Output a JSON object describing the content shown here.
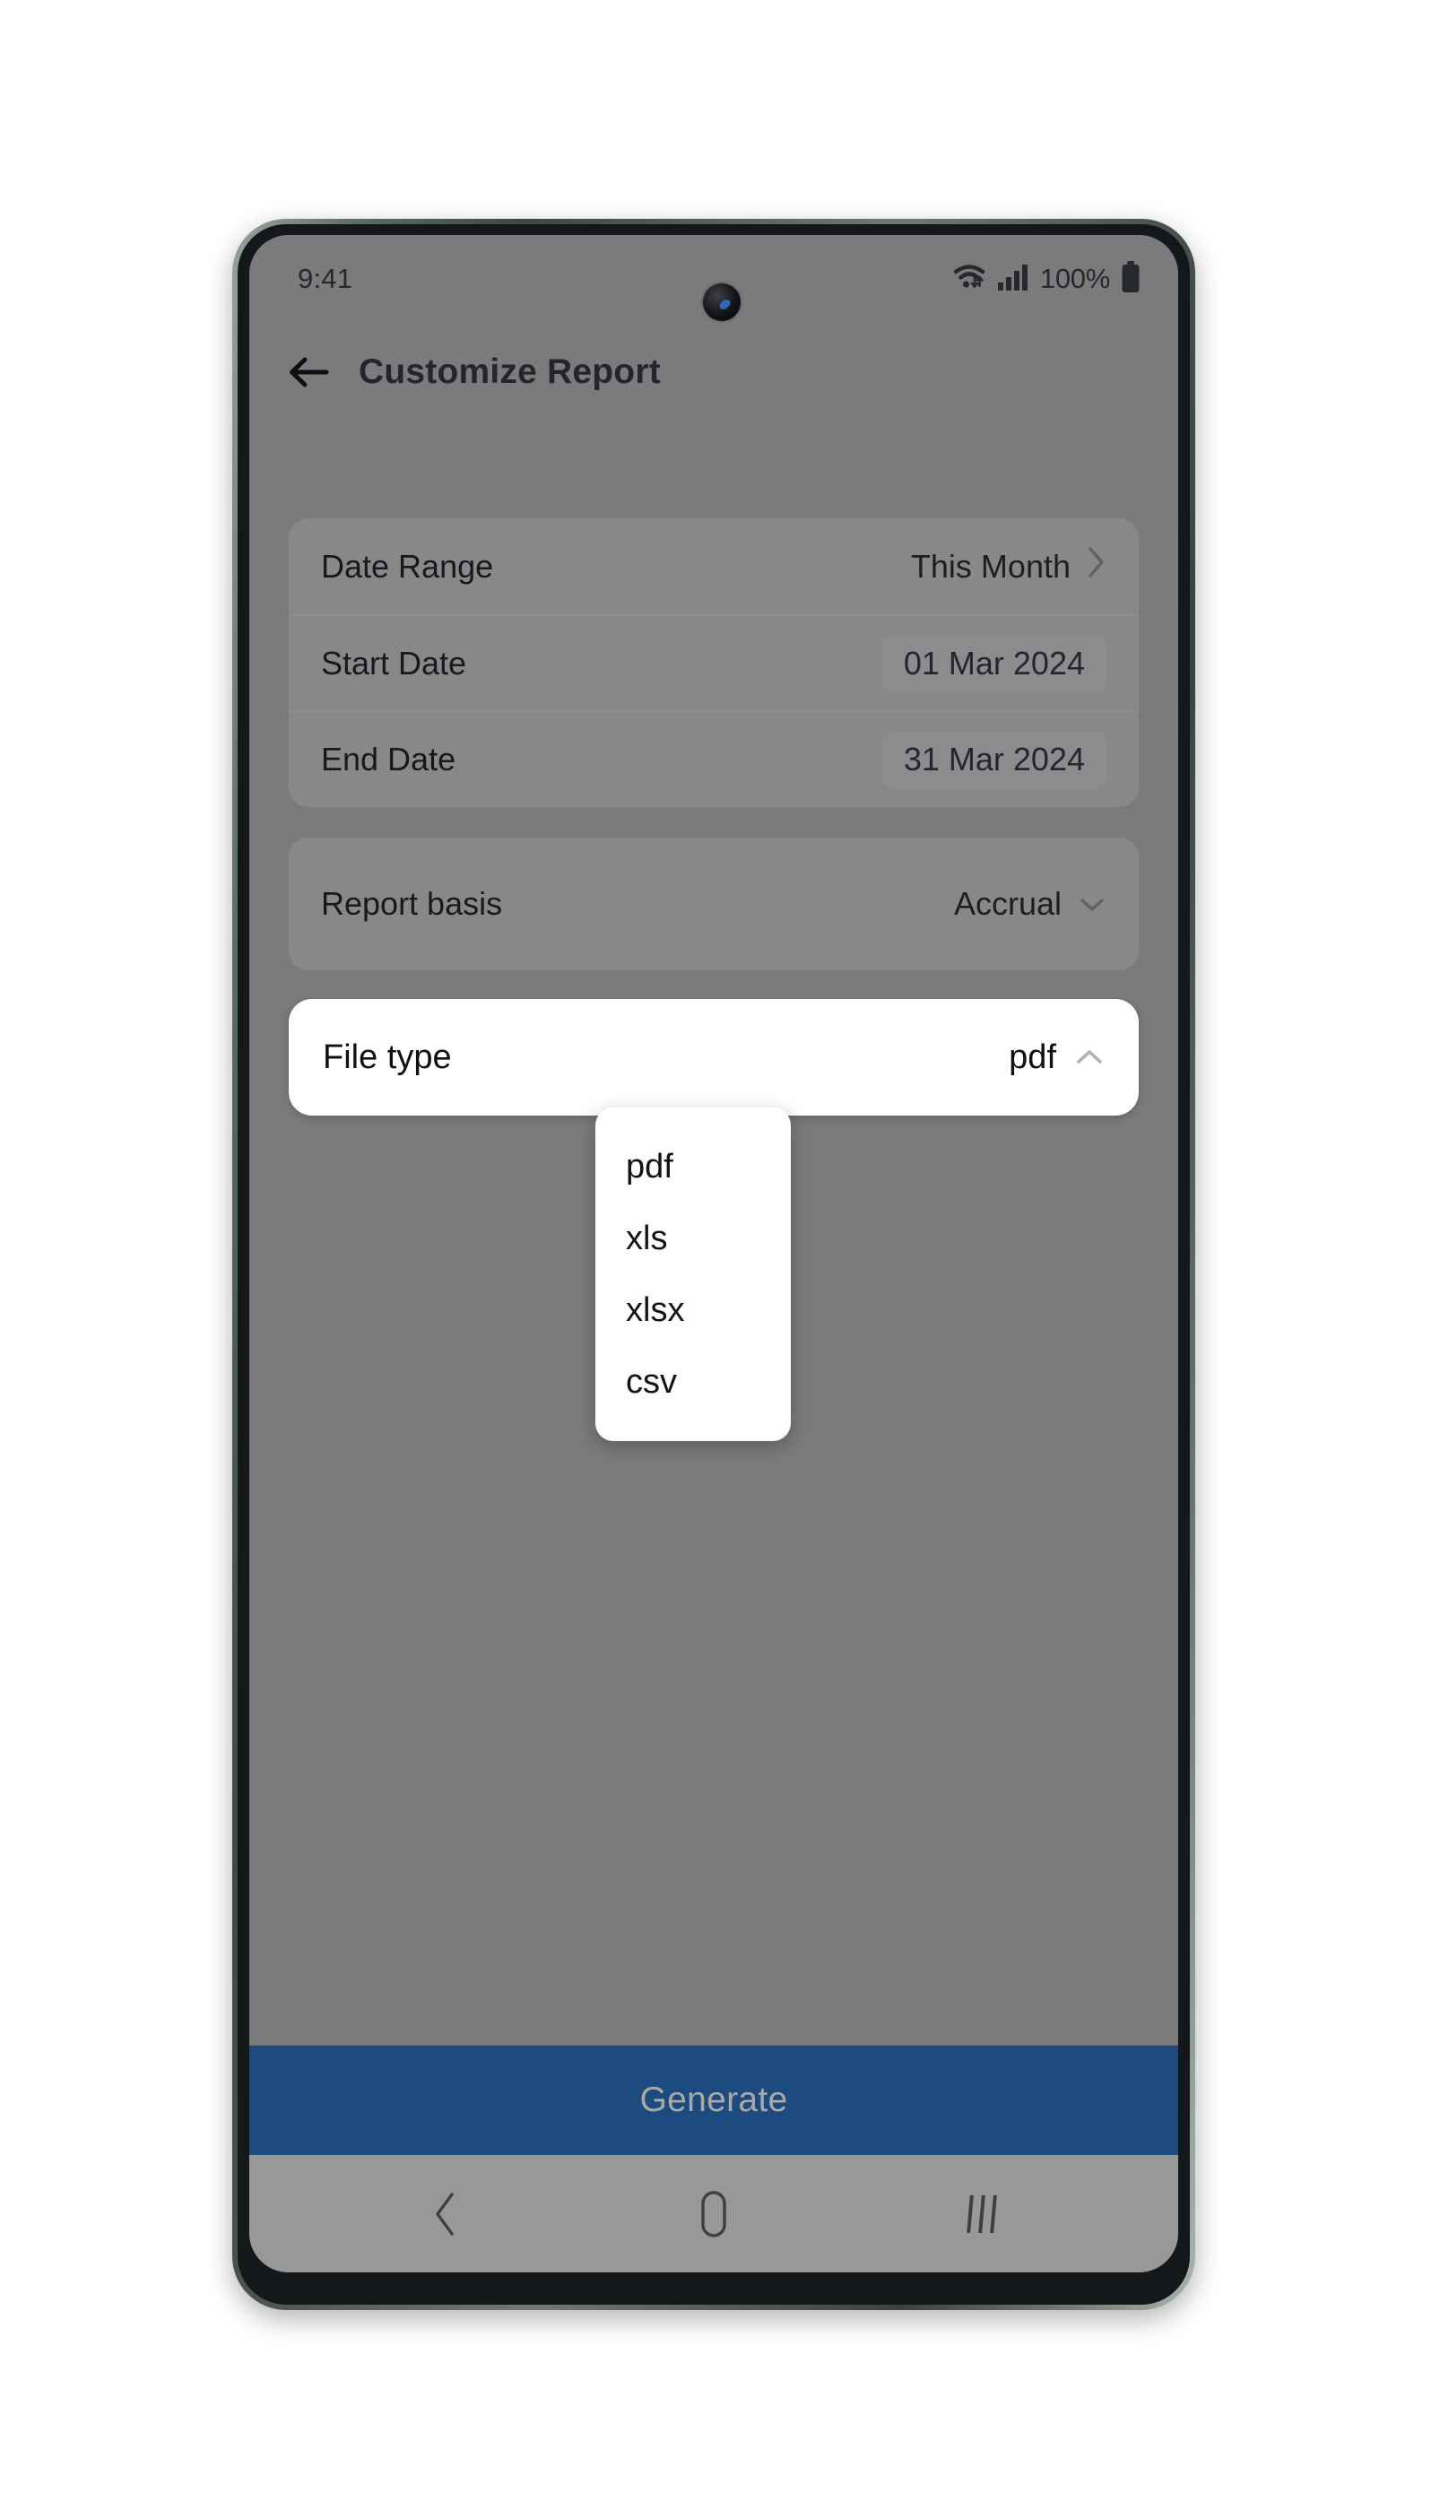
{
  "status_bar": {
    "time": "9:41",
    "battery_text": "100%",
    "wifi_icon": "wifi-icon",
    "signal_icon": "signal-bars-icon",
    "battery_icon": "battery-full-icon",
    "camera_icon": "front-camera-punch-hole"
  },
  "app_bar": {
    "back_icon": "back-arrow-icon",
    "title": "Customize Report"
  },
  "form": {
    "rows": [
      {
        "label": "Date Range",
        "value": "This Month",
        "trailing_icon": "chevron-right-icon",
        "style": "plain"
      },
      {
        "label": "Start Date",
        "value": "01 Mar 2024",
        "trailing_icon": "",
        "style": "pill"
      },
      {
        "label": "End Date",
        "value": "31 Mar 2024",
        "trailing_icon": "",
        "style": "pill"
      }
    ],
    "report_basis": {
      "label": "Report basis",
      "value": "Accrual",
      "trailing_icon": "chevron-down-icon"
    },
    "file_type": {
      "label": "File type",
      "value": "pdf",
      "trailing_icon": "chevron-up-icon",
      "expanded": true
    }
  },
  "dropdown": {
    "options": [
      "pdf",
      "xls",
      "xlsx",
      "csv"
    ],
    "selected": "pdf"
  },
  "actions": {
    "generate_label": "Generate"
  },
  "nav_bar": {
    "back_icon": "nav-back-icon",
    "home_icon": "nav-home-icon",
    "recents_icon": "nav-recents-icon"
  },
  "colors": {
    "accent_blue": "#1d4b80",
    "scrim_gray": "#7b7b7d",
    "card_gray": "#888889",
    "sheet_white": "#ffffff"
  }
}
